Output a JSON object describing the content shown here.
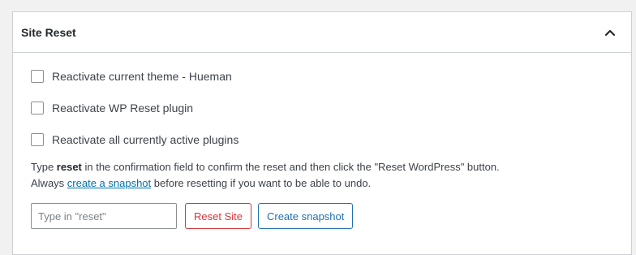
{
  "panel": {
    "title": "Site Reset",
    "collapse_icon": "chevron-up-icon"
  },
  "options": [
    {
      "label": "Reactivate current theme - Hueman",
      "checked": false
    },
    {
      "label": "Reactivate WP Reset plugin",
      "checked": false
    },
    {
      "label": "Reactivate all currently active plugins",
      "checked": false
    }
  ],
  "description": {
    "line1_pre": "Type ",
    "line1_bold": "reset",
    "line1_post": " in the confirmation field to confirm the reset and then click the \"Reset WordPress\" button.",
    "line2_pre": "Always ",
    "line2_link": "create a snapshot",
    "line2_post": " before resetting if you want to be able to undo."
  },
  "confirm_input": {
    "value": "",
    "placeholder": "Type in \"reset\""
  },
  "buttons": {
    "reset_site": "Reset Site",
    "create_snapshot": "Create snapshot"
  },
  "colors": {
    "link": "#0073aa",
    "danger": "#d63638",
    "secondary": "#2271b1",
    "border": "#ccd0d4"
  }
}
